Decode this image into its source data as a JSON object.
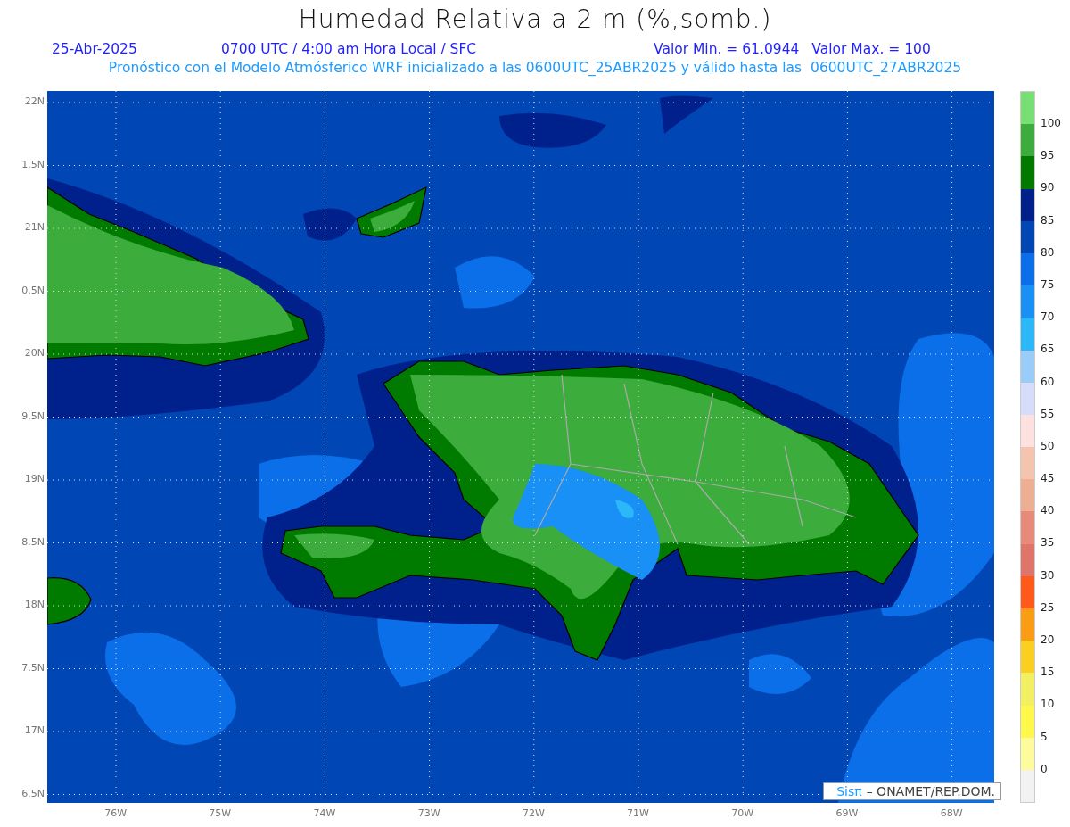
{
  "title": "Humedad Relativa a 2 m (%,somb.)",
  "info": {
    "date": "25-Abr-2025",
    "time": "0700 UTC / 4:00 am Hora Local / SFC",
    "min": "Valor Min. = 61.0944",
    "max": "Valor Max. = 100",
    "forecast": "Pronóstico con el Modelo Atmósferico WRF inicializado a las 0600UTC_25ABR2025 y válido hasta las  0600UTC_27ABR2025"
  },
  "map": {
    "lat_labels": [
      "22N",
      "1.5N",
      "21N",
      "0.5N",
      "20N",
      "9.5N",
      "19N",
      "8.5N",
      "18N",
      "7.5N",
      "17N",
      "6.5N"
    ],
    "lon_labels": [
      "76W",
      "75W",
      "74W",
      "73W",
      "72W",
      "71W",
      "70W",
      "69W",
      "68W"
    ]
  },
  "legend": {
    "colors": [
      {
        "color": "#77e072"
      },
      {
        "color": "#3cac3c"
      },
      {
        "color": "#007b00"
      },
      {
        "color": "#00208c"
      },
      {
        "color": "#0047b5"
      },
      {
        "color": "#0a6fe8"
      },
      {
        "color": "#1890f5"
      },
      {
        "color": "#2cb7f8"
      },
      {
        "color": "#99ccf8"
      },
      {
        "color": "#d6dcf9"
      },
      {
        "color": "#fde0e0"
      },
      {
        "color": "#f5c4ae"
      },
      {
        "color": "#eeae92"
      },
      {
        "color": "#e8897a"
      },
      {
        "color": "#e07468"
      },
      {
        "color": "#ff5a1a"
      },
      {
        "color": "#fa9c14"
      },
      {
        "color": "#fcce22"
      },
      {
        "color": "#f2ef60"
      },
      {
        "color": "#fef84b"
      },
      {
        "color": "#fefc9a"
      },
      {
        "color": "#f2f2f2"
      }
    ],
    "labels": [
      "100",
      "95",
      "90",
      "85",
      "80",
      "75",
      "70",
      "65",
      "60",
      "55",
      "50",
      "45",
      "40",
      "35",
      "30",
      "25",
      "20",
      "15",
      "10",
      "5",
      "0"
    ]
  },
  "credit": {
    "logo": "Sisπ",
    "text": "– ONAMET/REP.DOM."
  }
}
